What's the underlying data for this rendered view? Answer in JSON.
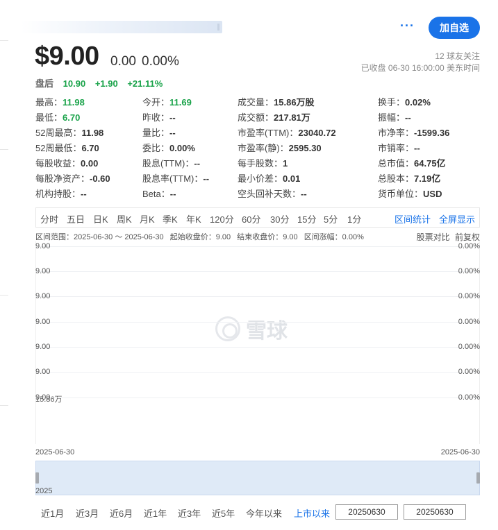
{
  "header": {
    "more_label": "···",
    "follow_label": "加自选",
    "price": "$9.00",
    "change": "0.00",
    "change_pct": "0.00%",
    "followers": "12 球友关注",
    "market_status": "已收盘 06-30 16:00:00 美东时间"
  },
  "after_hours": {
    "label": "盘后",
    "price": "10.90",
    "change": "+1.90",
    "change_pct": "+21.11%"
  },
  "quote": {
    "rows": [
      [
        [
          "最高：",
          "11.98",
          "green"
        ],
        [
          "今开：",
          "11.69",
          "green"
        ],
        [
          "成交量：",
          "15.86万股",
          ""
        ],
        [
          "换手：",
          "0.02%",
          ""
        ]
      ],
      [
        [
          "最低：",
          "6.70",
          "green"
        ],
        [
          "昨收：",
          "--",
          ""
        ],
        [
          "成交额：",
          "217.81万",
          ""
        ],
        [
          "振幅：",
          "--",
          ""
        ]
      ],
      [
        [
          "52周最高：",
          "11.98",
          ""
        ],
        [
          "量比：",
          "--",
          ""
        ],
        [
          "市盈率(TTM)：",
          "23040.72",
          ""
        ],
        [
          "市净率：",
          "-1599.36",
          ""
        ]
      ],
      [
        [
          "52周最低：",
          "6.70",
          ""
        ],
        [
          "委比：",
          "0.00%",
          ""
        ],
        [
          "市盈率(静)：",
          "2595.30",
          ""
        ],
        [
          "市销率：",
          "--",
          ""
        ]
      ],
      [
        [
          "每股收益：",
          "0.00",
          ""
        ],
        [
          "股息(TTM)：",
          "--",
          ""
        ],
        [
          "每手股数：",
          "1",
          ""
        ],
        [
          "总市值：",
          "64.75亿",
          ""
        ]
      ],
      [
        [
          "每股净资产：",
          "-0.60",
          ""
        ],
        [
          "股息率(TTM)：",
          "--",
          ""
        ],
        [
          "最小价差：",
          "0.01",
          ""
        ],
        [
          "总股本：",
          "7.19亿",
          ""
        ]
      ],
      [
        [
          "机构持股：",
          "--",
          ""
        ],
        [
          "Beta：",
          "--",
          ""
        ],
        [
          "空头回补天数：",
          "--",
          ""
        ],
        [
          "货币单位：",
          "USD",
          ""
        ]
      ]
    ]
  },
  "chart_tabs": [
    "分时",
    "五日",
    "日K",
    "周K",
    "月K",
    "季K",
    "年K",
    "120分",
    "60分",
    "30分",
    "15分",
    "5分",
    "1分"
  ],
  "chart_links": [
    "区间统计",
    "全屏显示"
  ],
  "range_info": {
    "range": "区间范围：2025-06-30 ～ 2025-06-30",
    "start": "起始收盘价：9.00",
    "end": "结束收盘价：9.00",
    "change": "区间涨幅：0.00%"
  },
  "right_info": [
    "股票对比",
    "前复权"
  ],
  "chart_data": {
    "type": "line",
    "x": [
      "2025-06-30"
    ],
    "series": [
      {
        "values": [
          9.0
        ]
      }
    ],
    "y_ticks": [
      "9.00",
      "9.00",
      "9.00",
      "9.00",
      "9.00",
      "9.00",
      "9.00"
    ],
    "y_ticks_right": [
      "0.00%",
      "0.00%",
      "0.00%",
      "0.00%",
      "0.00%",
      "0.00%",
      "0.00%"
    ],
    "volume_label": "15.86万",
    "x_start": "2025-06-30",
    "x_end": "2025-06-30",
    "grid": true
  },
  "watermark": "雪球",
  "navigator": {
    "year": "2025"
  },
  "periods": [
    "近1月",
    "近3月",
    "近6月",
    "近1年",
    "近3年",
    "近5年",
    "今年以来",
    "上市以来"
  ],
  "date_inputs": {
    "start": "20250630",
    "end": "20250630"
  }
}
